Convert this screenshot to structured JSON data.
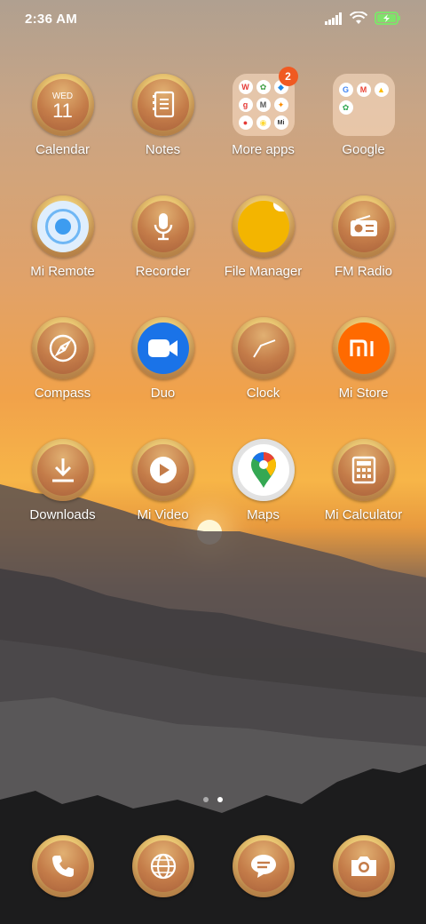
{
  "status": {
    "time": "2:36 AM"
  },
  "calendar": {
    "weekday": "WED",
    "day": "11"
  },
  "folders": {
    "more_apps_badge": "2"
  },
  "apps": [
    {
      "label": "Calendar"
    },
    {
      "label": "Notes"
    },
    {
      "label": "More apps"
    },
    {
      "label": "Google"
    },
    {
      "label": "Mi Remote"
    },
    {
      "label": "Recorder"
    },
    {
      "label": "File Manager"
    },
    {
      "label": "FM Radio"
    },
    {
      "label": "Compass"
    },
    {
      "label": "Duo"
    },
    {
      "label": "Clock"
    },
    {
      "label": "Mi Store"
    },
    {
      "label": "Downloads"
    },
    {
      "label": "Mi Video"
    },
    {
      "label": "Maps"
    },
    {
      "label": "Mi Calculator"
    }
  ],
  "dock": [
    {
      "icon": "phone-icon"
    },
    {
      "icon": "browser-icon"
    },
    {
      "icon": "messages-icon"
    },
    {
      "icon": "camera-icon"
    }
  ],
  "page_indicator": {
    "pages": 2,
    "current": 2
  },
  "colors": {
    "mi_store": "#ff6a00",
    "duo": "#1a73e8",
    "file_manager": "#f3b500",
    "badge": "#f05a22"
  }
}
